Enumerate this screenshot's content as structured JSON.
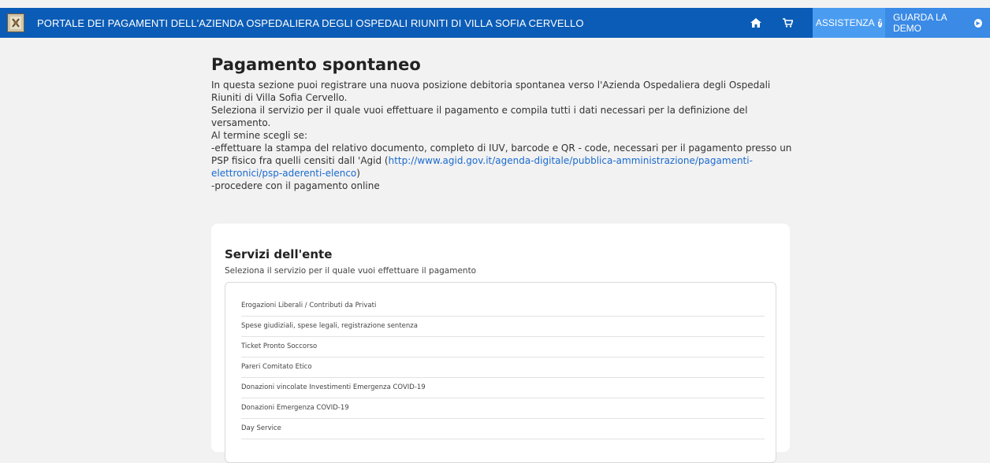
{
  "header": {
    "title": "PORTALE DEI PAGAMENTI DELL'AZIENDA OSPEDALIERA DEGLI OSPEDALI RIUNITI DI VILLA SOFIA CERVELLO",
    "home_icon": "home-icon",
    "cart_icon": "cart-icon",
    "assist_label": "ASSISTENZA",
    "demo_label": "GUARDA LA DEMO",
    "bar_color": "#0b5cb6"
  },
  "intro": {
    "title": "Pagamento spontaneo",
    "p1": "In questa sezione puoi registrare una nuova posizione debitoria spontanea verso l'Azienda Ospedaliera degli Ospedali Riuniti di Villa Sofia Cervello.",
    "p2": "Seleziona il servizio per il quale vuoi effettuare il pagamento e compila tutti i dati necessari per la definizione del versamento.",
    "p3": "Al termine scegli se:",
    "p4_prefix": "-effettuare la stampa del relativo documento, completo di IUV, barcode e QR - code, necessari per il pagamento presso un PSP fisico fra quelli censiti dall 'Agid (",
    "p4_link": "http://www.agid.gov.it/agenda-digitale/pubblica-amministrazione/pagamenti-elettronici/psp-aderenti-elenco",
    "p4_suffix": ")",
    "p5": "-procedere con il pagamento online"
  },
  "services": {
    "title": "Servizi dell'ente",
    "subtitle": "Seleziona il servizio per il quale vuoi effettuare il pagamento",
    "items": [
      "Erogazioni Liberali / Contributi da Privati",
      "Spese giudiziali, spese legali, registrazione sentenza",
      "Ticket Pronto Soccorso",
      "Pareri Comitato Etico",
      "Donazioni vincolate Investimenti Emergenza COVID-19",
      "Donazioni Emergenza COVID-19",
      "Day Service"
    ]
  }
}
